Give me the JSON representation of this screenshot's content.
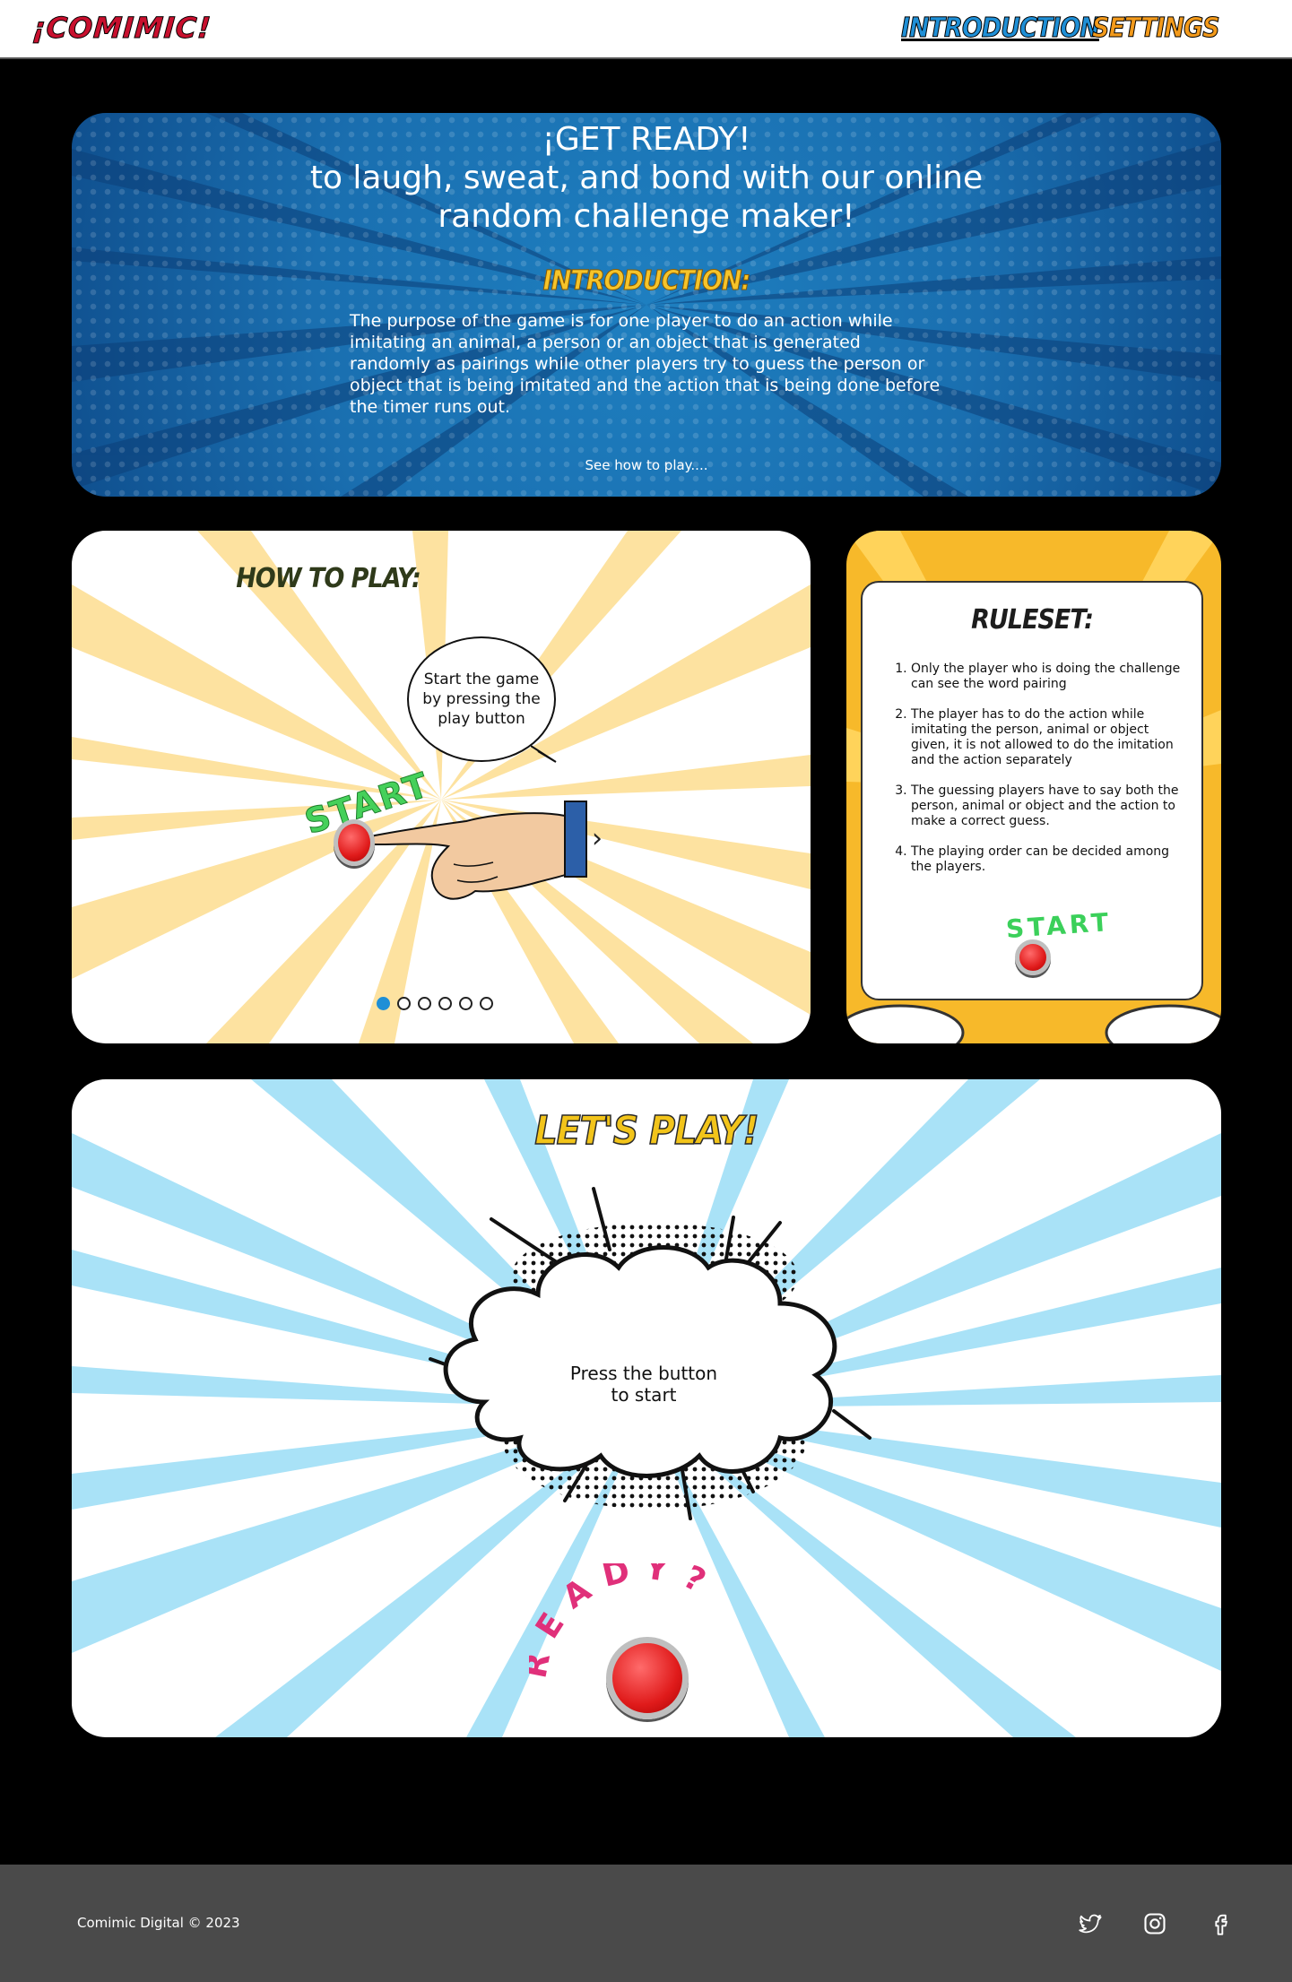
{
  "nav": {
    "logo": "¡COMIMIC!",
    "links": [
      "INTRODUCTION",
      "SETTINGS"
    ]
  },
  "intro": {
    "title_line1": "¡GET READY!",
    "title_line2": "to laugh, sweat, and bond with our online random challenge maker!",
    "heading": "INTRODUCTION:",
    "text": "The purpose of the game is for one player to do an action while imitating an animal, a person or an object that is generated randomly as pairings while other players try to guess the person or object that is being imitated and the action that is being done before the timer runs out.",
    "link": "See how to play...."
  },
  "how_to_play": {
    "title": "HOW TO PLAY:",
    "bubble_text": "Start the game by pressing the play button",
    "start_word": "START",
    "active_slide": 1,
    "slide_count": 6
  },
  "ruleset": {
    "title": "RULESET:",
    "rules": [
      "Only the player who is doing the challenge can see the word pairing",
      "The player has to do the action while imitating the person, animal or object given, it is not allowed to do the imitation and the action separately",
      "The guessing players have to say both the person, animal or object and the action to make a correct guess.",
      "The playing order can be decided among the players."
    ],
    "start_word": "START"
  },
  "play": {
    "title": "LET'S PLAY!",
    "cloud_text_line1": "Press the button",
    "cloud_text_line2": "to start",
    "ready_word": "READY?"
  },
  "footer": {
    "copyright": "Comimic Digital © 2023",
    "social": [
      "twitter-icon",
      "instagram-icon",
      "facebook-icon"
    ]
  },
  "colors": {
    "intro_blue": "#1a6fb0",
    "accent_yellow": "#f6c42a",
    "nav_blue": "#1f8fd6",
    "nav_orange": "#f39a1b",
    "ray_yellow": "#fde2a0",
    "ray_blue": "#a9e2f7",
    "ready_pink": "#e0307a"
  }
}
